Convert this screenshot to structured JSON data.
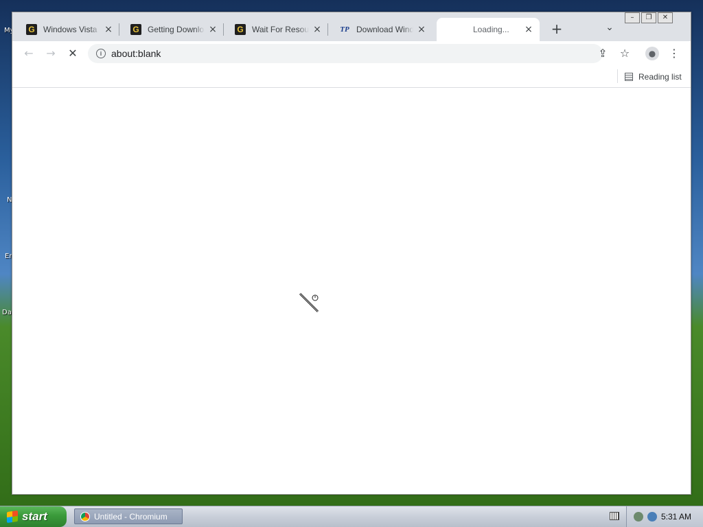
{
  "desktop": {
    "labels": [
      "My",
      "N",
      "Er",
      "Da"
    ]
  },
  "tabs": [
    {
      "title": "Windows Vista Ho",
      "favicon": "G",
      "favicon_name": "g-favicon-icon"
    },
    {
      "title": "Getting Download",
      "favicon": "G",
      "favicon_name": "g-favicon-icon"
    },
    {
      "title": "Wait For Resource",
      "favicon": "G",
      "favicon_name": "g-favicon-icon"
    },
    {
      "title": "Download Window",
      "favicon": "TP",
      "favicon_name": "tp-favicon-icon"
    },
    {
      "title": "Loading...",
      "favicon": "",
      "favicon_name": "loading-favicon-icon",
      "active": true
    }
  ],
  "tab_close_glyph": "×",
  "newtab_glyph": "+",
  "tab_search_glyph": "⌄",
  "window_buttons": {
    "minimize": "–",
    "restore": "❐",
    "close": "✕"
  },
  "toolbar": {
    "back_glyph": "←",
    "forward_glyph": "→",
    "stop_glyph": "✕",
    "url": "about:blank",
    "info_glyph": "i",
    "share_glyph": "⇪",
    "star_glyph": "☆",
    "profile_glyph": "●",
    "menu_glyph": "⋮"
  },
  "bookmarks_bar": {
    "reading_list": "Reading list"
  },
  "taskbar": {
    "start_label": "start",
    "task_label": "Untitled - Chromium",
    "clock": "5:31 AM"
  },
  "colors": {
    "tabstrip": "#dee1e6",
    "omnibox": "#f1f3f4",
    "start_green": "#3a9a3a",
    "taskbar": "#c9cfd9"
  }
}
